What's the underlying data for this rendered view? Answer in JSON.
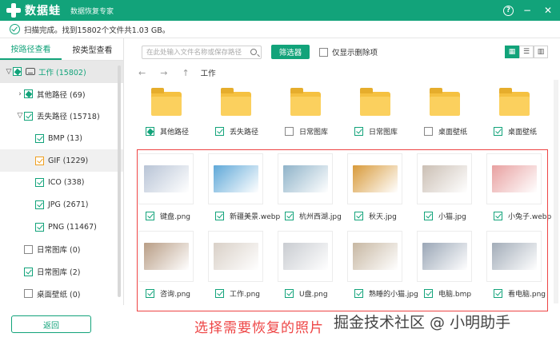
{
  "titlebar": {
    "brand": "数据蛙",
    "subtitle": "数据恢复专家",
    "help": "?",
    "minimize": "−",
    "close": "✕"
  },
  "status": {
    "text": "扫描完成。找到15802个文件共1.03 GB。"
  },
  "sidebar": {
    "tabs": [
      {
        "label": "按路径查看",
        "active": true
      },
      {
        "label": "按类型查看",
        "active": false
      }
    ],
    "tree": [
      {
        "label": "工作 (15802)",
        "level": 0,
        "chev": "▽",
        "check": "partial",
        "disk": true,
        "selected": true
      },
      {
        "label": "其他路径 (69)",
        "level": 1,
        "chev": "›",
        "check": "partial"
      },
      {
        "label": "丢失路径 (15718)",
        "level": 1,
        "chev": "▽",
        "check": "checked"
      },
      {
        "label": "BMP (13)",
        "level": 2,
        "check": "checked"
      },
      {
        "label": "GIF (1229)",
        "level": 2,
        "check": "orange",
        "highlight": true
      },
      {
        "label": "ICO (338)",
        "level": 2,
        "check": "checked"
      },
      {
        "label": "JPG (2671)",
        "level": 2,
        "check": "checked"
      },
      {
        "label": "PNG (11467)",
        "level": 2,
        "check": "checked"
      },
      {
        "label": "日常图库 (0)",
        "level": 1,
        "check": "none"
      },
      {
        "label": "日常图库 (2)",
        "level": 1,
        "check": "checked"
      },
      {
        "label": "桌面壁纸 (0)",
        "level": 1,
        "check": "none"
      }
    ],
    "back": "返回"
  },
  "toolbar": {
    "search_placeholder": "在此处输入文件名称或保存路径",
    "filter": "筛选器",
    "deleted_only": "仅显示删除项"
  },
  "nav": {
    "back": "←",
    "forward": "→",
    "up": "↑",
    "path": "工作"
  },
  "folders": [
    {
      "label": "其他路径",
      "check": "partial"
    },
    {
      "label": "丢失路径",
      "check": "checked"
    },
    {
      "label": "日常图库",
      "check": "none"
    },
    {
      "label": "日常图库",
      "check": "checked"
    },
    {
      "label": "桌面壁纸",
      "check": "none"
    },
    {
      "label": "桌面壁纸",
      "check": "checked"
    }
  ],
  "files": [
    {
      "label": "键盘.png",
      "icon": "keyboard-photo",
      "color": "#b8c4d6"
    },
    {
      "label": "新疆美景.webp",
      "icon": "landscape-photo",
      "color": "#5fa8d8"
    },
    {
      "label": "杭州西湖.jpg",
      "icon": "lake-photo",
      "color": "#8fb3c9"
    },
    {
      "label": "秋天.jpg",
      "icon": "autumn-photo",
      "color": "#d89a3a"
    },
    {
      "label": "小猫.jpg",
      "icon": "cat-photo",
      "color": "#cbbfb4"
    },
    {
      "label": "小兔子.webp",
      "icon": "rabbit-photo",
      "color": "#e8a0a0"
    },
    {
      "label": "咨询.png",
      "icon": "consult-photo",
      "color": "#b89d85"
    },
    {
      "label": "工作.png",
      "icon": "work-photo",
      "color": "#d9d0c7"
    },
    {
      "label": "U盘.png",
      "icon": "usb-photo",
      "color": "#c9ccd1"
    },
    {
      "label": "熟睡的小猫.jpg",
      "icon": "sleeping-cat-photo",
      "color": "#c7b7a2"
    },
    {
      "label": "电脑.bmp",
      "icon": "laptop-photo",
      "color": "#9aa6b6"
    },
    {
      "label": "看电脑.png",
      "icon": "watch-laptop-photo",
      "color": "#a2acb8"
    }
  ],
  "annotation": {
    "note": "选择需要恢复的照片",
    "watermark": "掘金技术社区 @ 小明助手"
  }
}
